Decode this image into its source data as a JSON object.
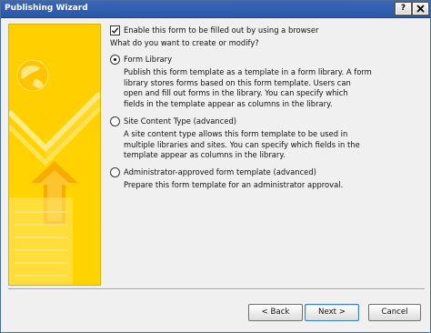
{
  "window": {
    "title": "Publishing Wizard",
    "help_label": "?",
    "close_label": "X"
  },
  "enable_checkbox": {
    "checked": true,
    "label": "Enable this form to be filled out by using a browser"
  },
  "question": "What do you want to create or modify?",
  "options": [
    {
      "selected": true,
      "label": "Form Library",
      "description_lines": [
        "Publish this form template as a template in a form library. A form",
        "library stores forms based on this form template. Users can",
        "open and fill out forms in the library. You can specify which",
        "fields in the template appear as columns in the library."
      ]
    },
    {
      "selected": false,
      "label": "Site Content Type (advanced)",
      "description_lines": [
        "A site content type allows this form template to be used in",
        "multiple libraries and sites. You can specify which fields in the",
        "template appear as columns in the library."
      ]
    },
    {
      "selected": false,
      "label": "Administrator-approved form template (advanced)",
      "description_lines": [
        "Prepare this form template for an administrator approval."
      ]
    }
  ],
  "buttons": {
    "back": "< Back",
    "next": "Next >",
    "cancel": "Cancel"
  },
  "colors": {
    "titlebar": "#2b57a8",
    "art_yellow": "#ffd300",
    "art_orange": "#f6a800"
  },
  "icons": {
    "art_globe": "globe-icon",
    "art_arrow": "up-arrow-icon"
  }
}
